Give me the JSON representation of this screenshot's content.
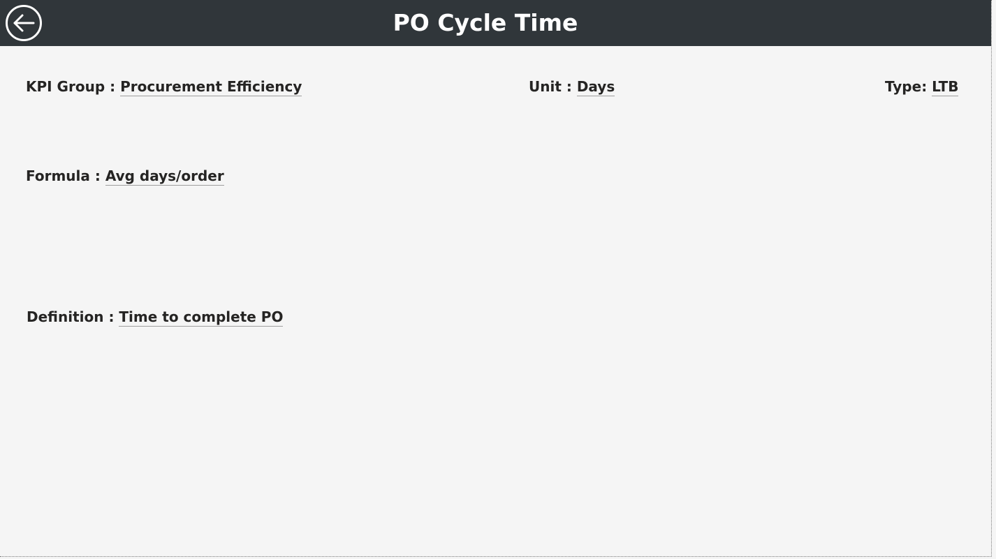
{
  "header": {
    "title": "PO Cycle Time",
    "back_icon": "arrow-left-circle-icon",
    "background_color": "#30363a"
  },
  "fields": {
    "kpi_group": {
      "label": "KPI Group : ",
      "value": "Procurement Efficiency"
    },
    "unit": {
      "label": "Unit : ",
      "value": "Days"
    },
    "type": {
      "label": "Type: ",
      "value": "LTB"
    },
    "formula": {
      "label": "Formula : ",
      "value": "Avg days/order"
    },
    "definition": {
      "label": "Definition : ",
      "value": "Time to complete PO"
    }
  },
  "colors": {
    "page_background": "#f5f5f5",
    "text": "#252423",
    "title_text": "#ffffff"
  }
}
